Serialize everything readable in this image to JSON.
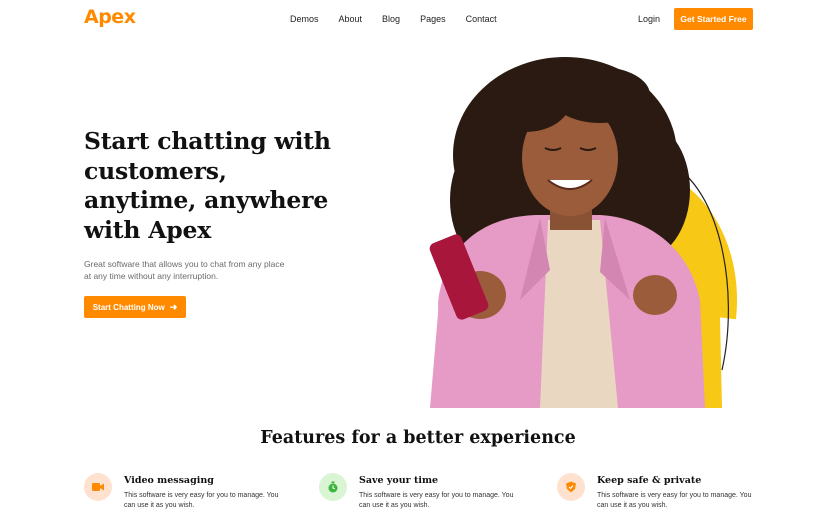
{
  "brand": {
    "name": "Apex",
    "accent": "#ff8a00"
  },
  "nav": {
    "items": [
      "Demos",
      "About",
      "Blog",
      "Pages",
      "Contact"
    ],
    "login": "Login",
    "cta": "Get Started Free"
  },
  "hero": {
    "title_lines": [
      "Start chatting with",
      "customers,",
      "anytime, anywhere",
      "with Apex"
    ],
    "subtitle": "Great software that allows you to chat from any place at any time without any interruption.",
    "cta": "Start Chatting Now",
    "cta_icon": "arrow-right-icon"
  },
  "features": {
    "title": "Features for a better experience",
    "items": [
      {
        "title": "Video messaging",
        "desc": "This software is very easy for you to manage. You can use it as you wish.",
        "icon": "video-icon",
        "icon_color": "#ff8a00"
      },
      {
        "title": "Save your time",
        "desc": "This software is very easy for you to manage. You can use it as you wish.",
        "icon": "timer-icon",
        "icon_color": "#3bb53b"
      },
      {
        "title": "Keep safe & private",
        "desc": "This software is very easy for you to manage. You can use it as you wish.",
        "icon": "shield-icon",
        "icon_color": "#ff8a00"
      }
    ]
  }
}
